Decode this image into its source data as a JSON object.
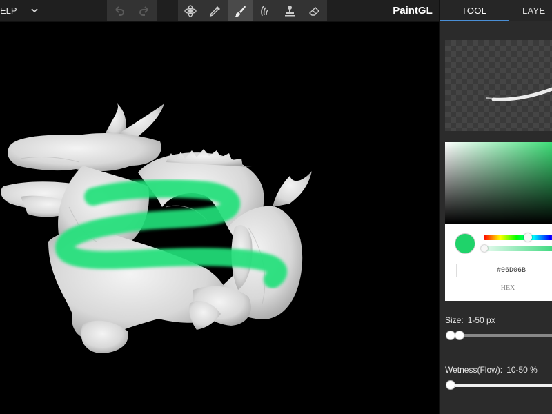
{
  "menu": {
    "help_label": "ELP"
  },
  "app": {
    "title": "PaintGL"
  },
  "toolbar": {
    "history": [
      {
        "name": "undo-icon",
        "enabled": false
      },
      {
        "name": "redo-icon",
        "enabled": false
      }
    ],
    "tools": [
      {
        "name": "rotate-model-icon",
        "active": false
      },
      {
        "name": "eyedropper-icon",
        "active": false
      },
      {
        "name": "brush-icon",
        "active": true
      },
      {
        "name": "smudge-icon",
        "active": false
      },
      {
        "name": "stamp-icon",
        "active": false
      },
      {
        "name": "eraser-icon",
        "active": false
      }
    ]
  },
  "tabs": {
    "tool": "TOOL",
    "layer": "LAYE"
  },
  "color": {
    "hex": "#06D06B",
    "hex_label": "HEX",
    "accent": "#1fd36a"
  },
  "size": {
    "label": "Size:",
    "range": "1-50 px",
    "min": 1,
    "max": 50,
    "low": 1,
    "high": 5
  },
  "wetness": {
    "label": "Wetness(Flow):",
    "range": "10-50 %",
    "min": 10,
    "max": 50,
    "low": 10,
    "high": 50
  }
}
